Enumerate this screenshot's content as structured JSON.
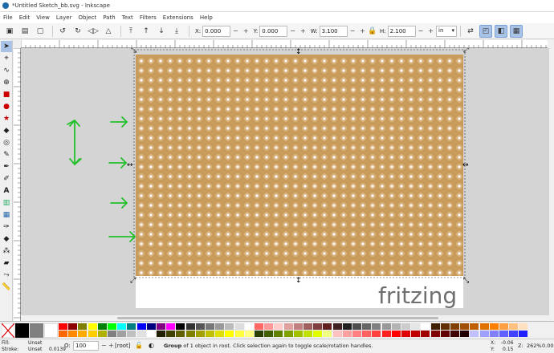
{
  "window": {
    "title": "*Untitled Sketch_bb.svg - Inkscape"
  },
  "menu": [
    "File",
    "Edit",
    "View",
    "Layer",
    "Object",
    "Path",
    "Text",
    "Filters",
    "Extensions",
    "Help"
  ],
  "toolbar": {
    "x_label": "X:",
    "x_value": "0.000",
    "y_label": "Y:",
    "y_value": "0.000",
    "w_label": "W:",
    "w_value": "3.100",
    "h_label": "H:",
    "h_value": "2.100",
    "unit": "in",
    "stepper_minus": "−",
    "stepper_plus": "+"
  },
  "canvas": {
    "logo_text": "fritzing",
    "board_color": "#c89b5a",
    "hole_color": "#ffffff",
    "annotation_color": "#22c02a",
    "hole_columns": 34,
    "hole_rows": 23
  },
  "palette": {
    "row1": [
      "#ff0000",
      "#8b0000",
      "#808000",
      "#ffff00",
      "#008000",
      "#00ff00",
      "#00ffff",
      "#008080",
      "#0000ff",
      "#000080",
      "#800080",
      "#ff00ff",
      "#000000",
      "#333333",
      "#555555",
      "#777777",
      "#999999",
      "#bbbbbb",
      "#dddddd",
      "#ffffff",
      "#ff6666",
      "#ff9999",
      "#ffcccc",
      "#e0a0a0",
      "#c08080",
      "#a06060",
      "#804040",
      "#602020",
      "#402020",
      "#202020",
      "#4d4d4d",
      "#666666",
      "#808080",
      "#999999",
      "#b3b3b3",
      "#cccccc",
      "#e6e6e6",
      "#ffffff",
      "#402000",
      "#603000",
      "#804000",
      "#a05000",
      "#c06000",
      "#e07000",
      "#ff8000",
      "#ffa040",
      "#ffc080",
      "#ffe0c0"
    ],
    "row2": [
      "#ff6600",
      "#ff8800",
      "#ffaa00",
      "#ffcc00",
      "#b0b000",
      "#808080",
      "#a0a0a0",
      "#c0c0c0",
      "#e0e0e0",
      "#ffffff",
      "#202000",
      "#404000",
      "#606000",
      "#808000",
      "#a0a000",
      "#c0c000",
      "#e0e000",
      "#ffff00",
      "#ffff40",
      "#ffff80",
      "#2a4000",
      "#406000",
      "#608000",
      "#80a000",
      "#a0c000",
      "#c0e000",
      "#e0ff00",
      "#f0ff80",
      "#ffc0c0",
      "#ffa0a0",
      "#ff8080",
      "#ff6060",
      "#ff4040",
      "#ff2020",
      "#ff0000",
      "#e00000",
      "#c00000",
      "#a00000",
      "#800000",
      "#600000",
      "#400000",
      "#200000",
      "#c0c0ff",
      "#a0a0ff",
      "#8080ff",
      "#6060ff",
      "#4040ff",
      "#2020ff"
    ]
  },
  "status": {
    "fill_label": "Fill:",
    "fill_value": "Unset",
    "stroke_label": "Stroke:",
    "stroke_value": "Unset",
    "stroke_width": "0.0139",
    "opacity_label": "O:",
    "opacity_value": "100",
    "layer": "[root]",
    "message_bold": "Group",
    "message": " of 1 object in root. Click selection again to toggle scale/rotation handles.",
    "x_label": "X:",
    "x_value": "-0.06",
    "y_label": "Y:",
    "y_value": "0.15",
    "zoom_label": "Z:",
    "zoom_value": "262%",
    "rotation_value": "0.00"
  },
  "icons": [
    "selector-tool-icon",
    "node-tool-icon",
    "tweak-tool-icon",
    "zoom-tool-icon",
    "rect-tool-icon",
    "circle-tool-icon",
    "star-tool-icon",
    "3d-box-tool-icon",
    "spiral-tool-icon",
    "pencil-tool-icon",
    "pen-tool-icon",
    "calligraphy-tool-icon",
    "text-tool-icon",
    "gradient-tool-icon",
    "mesh-tool-icon",
    "dropper-tool-icon",
    "paint-bucket-tool-icon",
    "spray-tool-icon",
    "eraser-tool-icon",
    "connector-tool-icon",
    "measure-tool-icon"
  ]
}
